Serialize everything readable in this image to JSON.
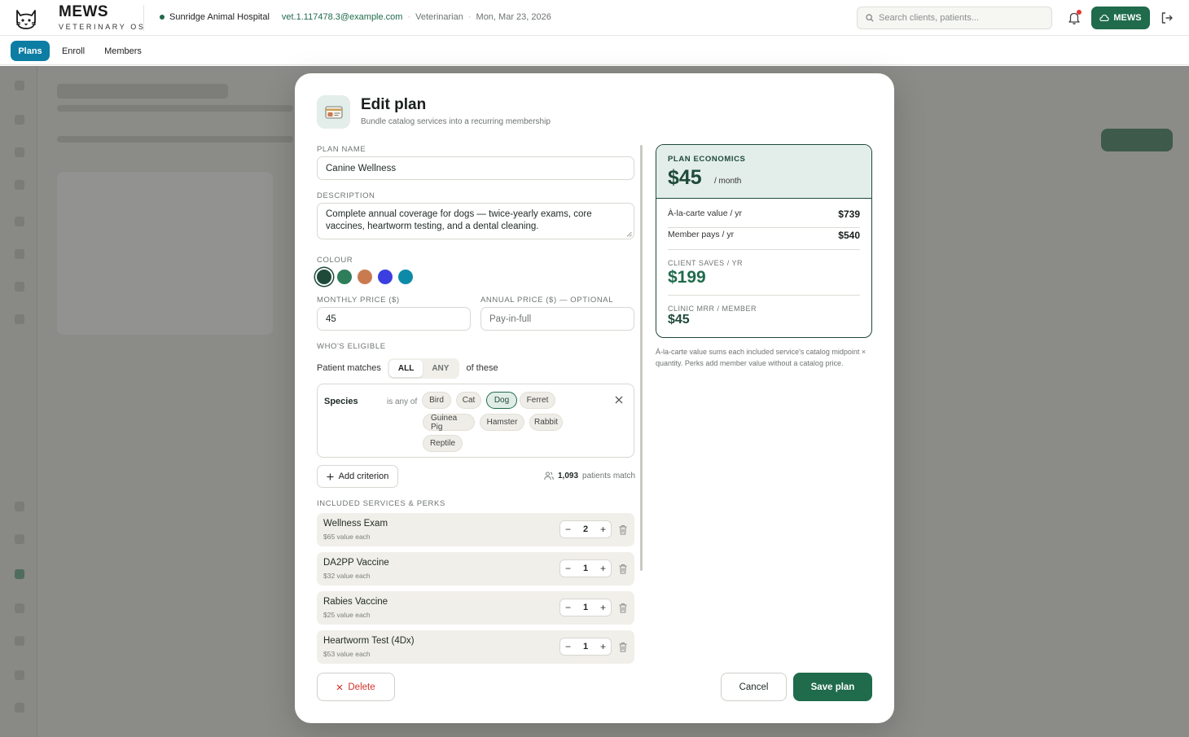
{
  "header": {
    "brand_name": "MEWS",
    "brand_sub": "VETERINARY OS",
    "hospital": "Sunridge Animal Hospital",
    "email": "vet.1.117478.3@example.com",
    "role": "Veterinarian",
    "date": "Mon, Mar 23, 2026",
    "search_placeholder": "Search clients, patients...",
    "account_button": "MEWS"
  },
  "tabs": [
    "Plans",
    "Enroll",
    "Members"
  ],
  "modal": {
    "title": "Edit plan",
    "subtitle": "Bundle catalog services into a recurring membership",
    "plan_name_label": "PLAN NAME",
    "plan_name": "Canine Wellness",
    "description_label": "DESCRIPTION",
    "description": "Complete annual coverage for dogs — twice-yearly exams, core vaccines, heartworm testing, and a dental cleaning.",
    "colour_label": "COLOUR",
    "colours": [
      "#1f4a3a",
      "#2e7d5b",
      "#c97a50",
      "#3b3fe0",
      "#0d8aa8"
    ],
    "monthly_label": "MONTHLY PRICE ($)",
    "monthly_value": "45",
    "annual_label": "ANNUAL PRICE ($) — OPTIONAL",
    "annual_placeholder": "Pay-in-full",
    "eligible_label": "WHO'S ELIGIBLE",
    "patient_matches": "Patient matches",
    "match_all": "ALL",
    "match_any": "ANY",
    "of_these": "of these",
    "criterion": {
      "field": "Species",
      "operator": "is any of",
      "options": [
        "Bird",
        "Cat",
        "Dog",
        "Ferret",
        "Guinea Pig",
        "Hamster",
        "Rabbit",
        "Reptile"
      ],
      "selected": "Dog"
    },
    "add_criterion": "Add criterion",
    "patients_count": "1,093",
    "patients_suffix": "patients match",
    "services_label": "INCLUDED SERVICES & PERKS",
    "services": [
      {
        "name": "Wellness Exam",
        "value": "$65 value each",
        "qty": "2"
      },
      {
        "name": "DA2PP Vaccine",
        "value": "$32 value each",
        "qty": "1"
      },
      {
        "name": "Rabies Vaccine",
        "value": "$25 value each",
        "qty": "1"
      },
      {
        "name": "Heartworm Test (4Dx)",
        "value": "$53 value each",
        "qty": "1"
      }
    ],
    "delete": "Delete",
    "cancel": "Cancel",
    "save": "Save plan"
  },
  "economics": {
    "label": "PLAN ECONOMICS",
    "price": "$45",
    "per": "/ month",
    "alacarte_label": "À-la-carte value / yr",
    "alacarte_value": "$739",
    "member_label": "Member pays / yr",
    "member_value": "$540",
    "saves_label": "CLIENT SAVES / YR",
    "saves_value": "$199",
    "mrr_label": "CLINIC MRR / MEMBER",
    "mrr_value": "$45",
    "note": "À-la-carte value sums each included service's catalog midpoint × quantity. Perks add member value without a catalog price."
  }
}
